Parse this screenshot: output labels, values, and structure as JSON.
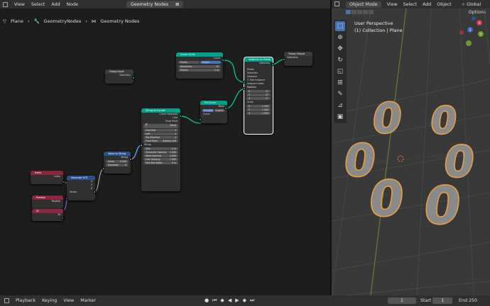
{
  "node_editor": {
    "menu": [
      "View",
      "Select",
      "Add",
      "Node"
    ],
    "node_tree": "Geometry Nodes",
    "breadcrumb": [
      "Plane",
      "GeometryNodes",
      "Geometry Nodes"
    ],
    "nodes": {
      "curve_circle": {
        "title": "Curve Circle",
        "out": "Curve",
        "mode_a": "Points",
        "mode_b": "Radius",
        "resolution_label": "Resolution",
        "resolution_value": "32",
        "radius_label": "Radius",
        "radius_value": "1 m"
      },
      "group_input": {
        "title": "Group Input",
        "out": "Geometry"
      },
      "instance_on_points": {
        "title": "Instance on Points",
        "out": "Instances",
        "inputs": [
          "Points",
          "Selection",
          "Instance",
          "Pick Instance",
          "Instance Index",
          "Rotation"
        ],
        "rot": [
          [
            "X",
            "0°"
          ],
          [
            "Y",
            "0°"
          ],
          [
            "Z",
            "0°"
          ]
        ],
        "scale_label": "Scale",
        "scale": [
          [
            "X",
            "1.000"
          ],
          [
            "Y",
            "1.000"
          ],
          [
            "Z",
            "1.000"
          ]
        ]
      },
      "group_output": {
        "title": "Group Output",
        "in": "Geometry"
      },
      "fill_curve": {
        "title": "Fill Curve",
        "out": "Mesh",
        "mode_a": "Triangles",
        "mode_b": "N-gons",
        "in": "Curve"
      },
      "string_to_curves": {
        "title": "String to Curves",
        "outs": [
          "Curve Instances",
          "Line",
          "Pivot Point"
        ],
        "font": "Bfont",
        "overflow": "Overflow",
        "align_x": "Left",
        "align_y": "Top Baseline",
        "pivot_label": "Pivot Point",
        "pivot_value": "Bottom Left",
        "string_label": "String",
        "fields": [
          [
            "Size",
            "1 m"
          ],
          [
            "Character Spacing",
            "1.000"
          ],
          [
            "Word Spacing",
            "1.000"
          ],
          [
            "Line Spacing",
            "1.000"
          ],
          [
            "Text Box Width",
            "0 m"
          ]
        ]
      },
      "value_to_string": {
        "title": "Value to String",
        "out": "String",
        "value_label": "Value",
        "value": "0.000",
        "decimals_label": "Decimals",
        "decimals": "0"
      },
      "index": {
        "title": "Index",
        "out": "Index"
      },
      "separate_xyz": {
        "title": "Separate XYZ",
        "outs": [
          "X",
          "Y",
          "Z"
        ],
        "in": "Vector"
      },
      "position": {
        "title": "Position",
        "out": "Position"
      },
      "id": {
        "title": "ID",
        "out": "ID"
      }
    }
  },
  "viewport": {
    "mode": "Object Mode",
    "menu": [
      "View",
      "Select",
      "Add",
      "Object"
    ],
    "transform": "Global",
    "options": "Options",
    "title_line1": "User Perspective",
    "title_line2": "(1) Collection | Plane",
    "tools": [
      "cursor-select",
      "cursor",
      "move",
      "rotate",
      "scale",
      "transform",
      "annotate",
      "measure",
      "add-cube"
    ],
    "digits": [
      "0",
      "0",
      "0",
      "0",
      "0",
      "0"
    ],
    "gizmo": {
      "x": "X",
      "y": "Y",
      "z": "Z"
    }
  },
  "timeline": {
    "menu": [
      "Playback",
      "Keying",
      "View",
      "Marker"
    ],
    "current_frame": "1",
    "start_label": "Start",
    "start": "1",
    "end_label": "End",
    "end": "250"
  },
  "colors": {
    "geometry_header": "#00a18a",
    "input_header": "#8a2640",
    "utility_header": "#29518a",
    "selection_outline": "#f0a040",
    "active_tool": "#4772b3"
  }
}
